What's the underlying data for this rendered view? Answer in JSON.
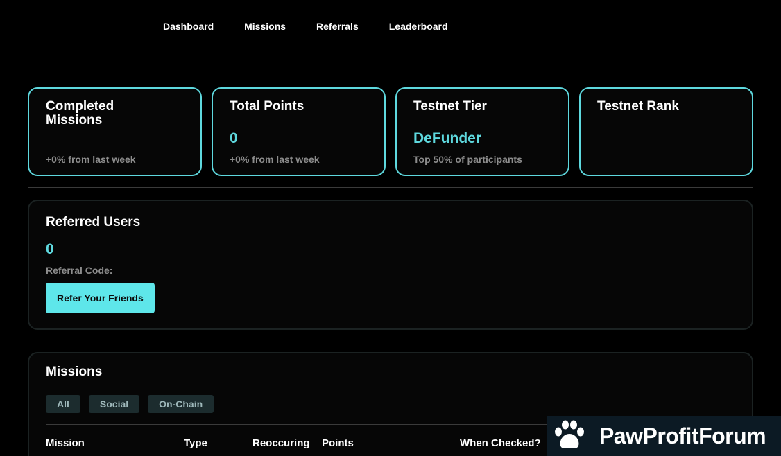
{
  "nav": {
    "items": [
      "Dashboard",
      "Missions",
      "Referrals",
      "Leaderboard"
    ]
  },
  "stats": [
    {
      "title": "Completed Missions",
      "value": "",
      "sub": "+0% from last week"
    },
    {
      "title": "Total Points",
      "value": "0",
      "sub": "+0% from last week"
    },
    {
      "title": "Testnet Tier",
      "value": "DeFunder",
      "sub": "Top 50% of participants"
    },
    {
      "title": "Testnet Rank",
      "value": "",
      "sub": ""
    }
  ],
  "referrals": {
    "title": "Referred Users",
    "count": "0",
    "code_label": "Referral Code:",
    "button": "Refer Your Friends"
  },
  "missions": {
    "title": "Missions",
    "filters": [
      "All",
      "Social",
      "On-Chain"
    ],
    "columns": [
      "Mission",
      "Type",
      "Reoccuring",
      "Points",
      "When Checked?"
    ]
  },
  "watermark": {
    "text": "PawProfitForum"
  },
  "colors": {
    "accent": "#5ed8de",
    "button": "#5ee6ea",
    "background": "#000000"
  }
}
